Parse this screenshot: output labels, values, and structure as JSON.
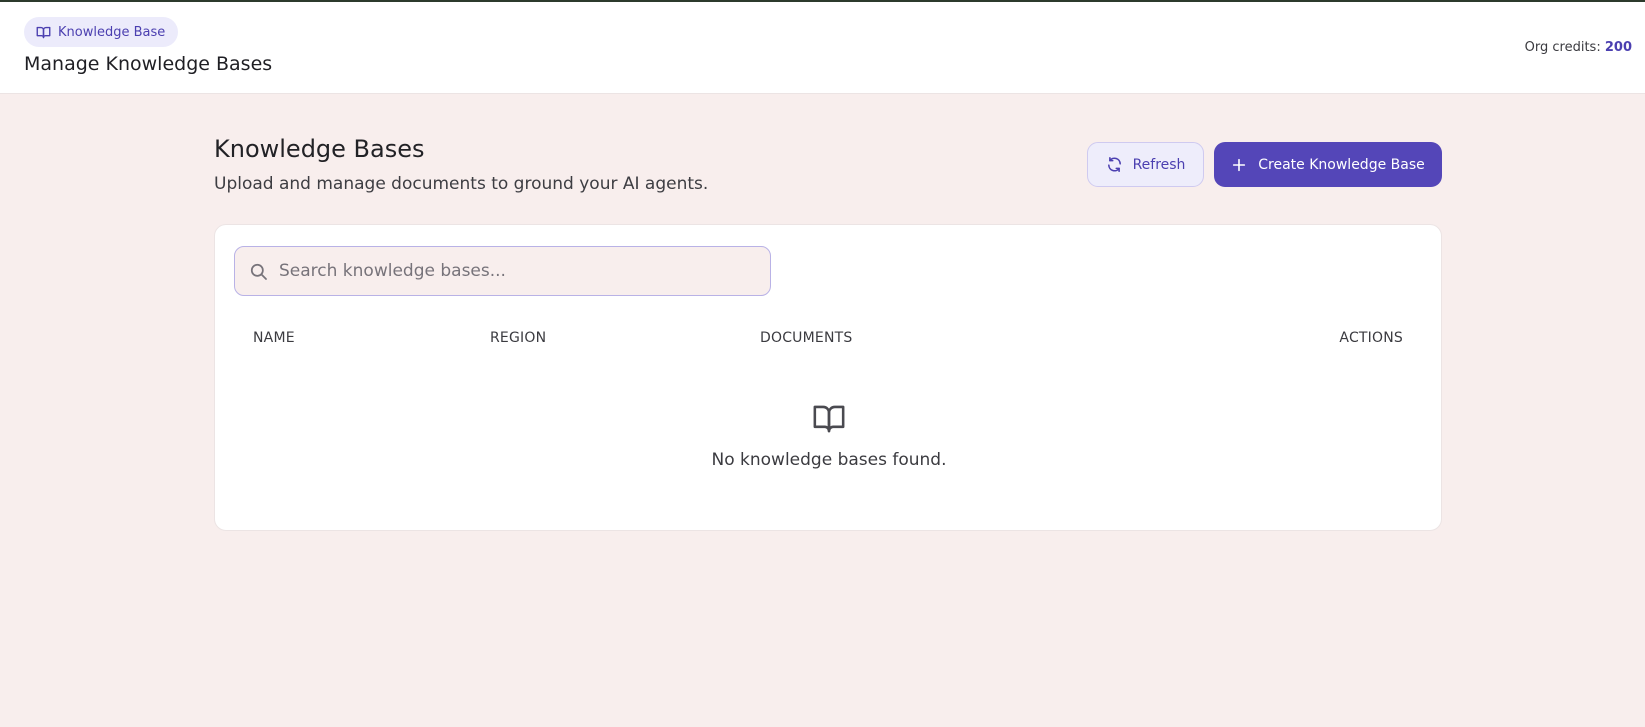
{
  "header": {
    "breadcrumb_label": "Knowledge Base",
    "breadcrumb_icon": "book-open-icon",
    "title": "Manage Knowledge Bases",
    "credits_label": "Org credits:",
    "credits_value": "200"
  },
  "main": {
    "title": "Knowledge Bases",
    "subtitle": "Upload and manage documents to ground your AI agents.",
    "buttons": {
      "refresh_label": "Refresh",
      "refresh_icon": "refresh-icon",
      "create_label": "Create Knowledge Base",
      "create_icon": "plus-icon"
    },
    "search": {
      "placeholder": "Search knowledge bases...",
      "value": "",
      "icon": "search-icon"
    },
    "table": {
      "columns": [
        "NAME",
        "REGION",
        "DOCUMENTS",
        "ACTIONS"
      ],
      "rows": []
    },
    "empty_state": {
      "icon": "book-open-icon",
      "text": "No knowledge bases found."
    }
  },
  "colors": {
    "accent": "#5446b8",
    "accent_text": "#4b3fb0",
    "page_background": "#f8eeed",
    "card_background": "#ffffff"
  }
}
